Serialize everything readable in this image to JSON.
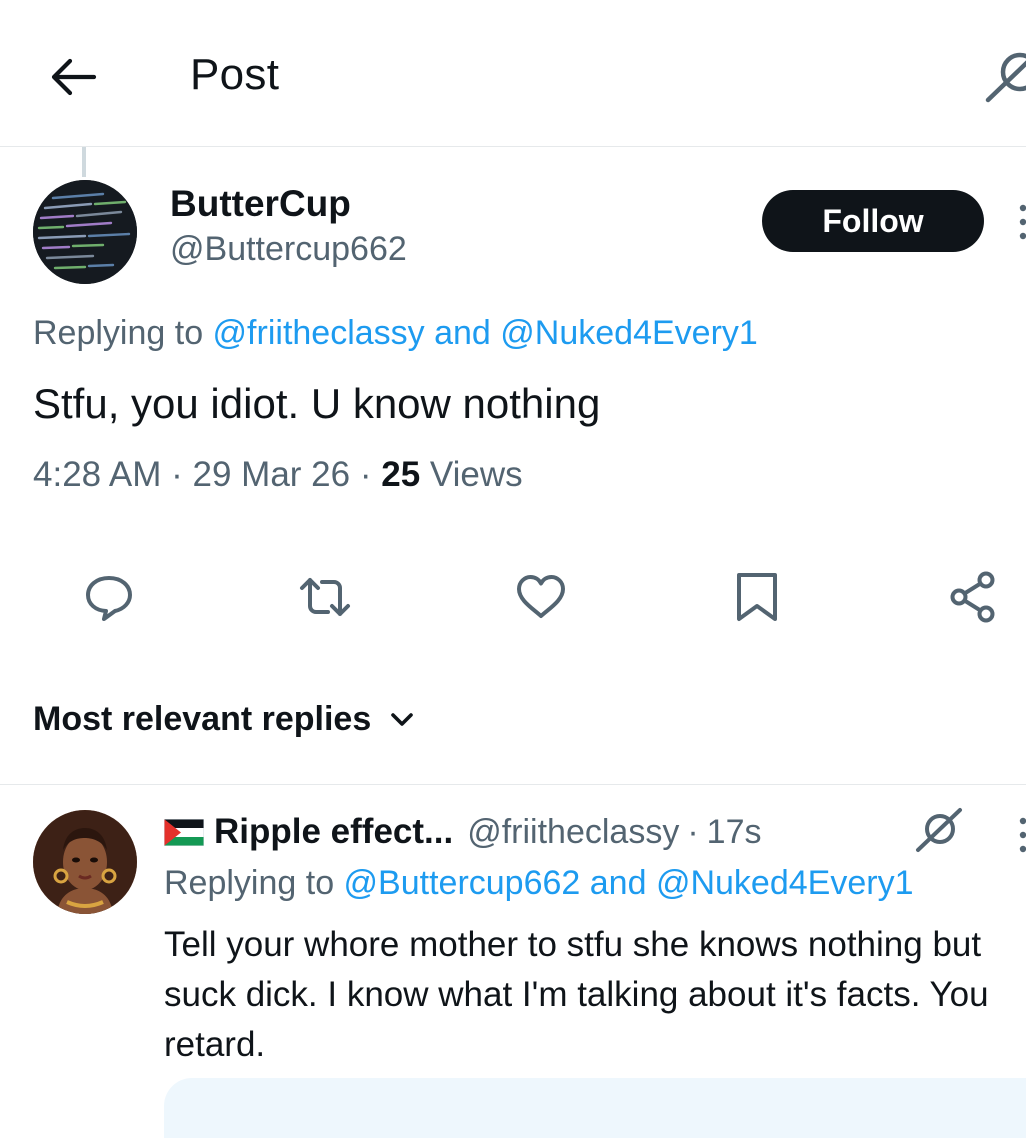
{
  "header": {
    "title": "Post",
    "back_icon": "arrow-left-icon",
    "grok_icon": "grok-icon"
  },
  "post": {
    "author": {
      "display_name": "ButterCup",
      "handle": "@Buttercup662"
    },
    "follow_label": "Follow",
    "replying_prefix": "Replying to ",
    "replying_to": [
      "@friitheclassy",
      "@Nuked4Every1"
    ],
    "replying_joiner": " and ",
    "text": "Stfu, you idiot. U know nothing",
    "time": "4:28 AM",
    "date": "29 Mar 26",
    "views_count": "25",
    "views_label": "Views",
    "separator": " · "
  },
  "actions": [
    {
      "name": "reply",
      "icon": "reply-icon"
    },
    {
      "name": "repost",
      "icon": "repost-icon"
    },
    {
      "name": "like",
      "icon": "heart-icon"
    },
    {
      "name": "bookmark",
      "icon": "bookmark-icon"
    },
    {
      "name": "share",
      "icon": "share-icon"
    }
  ],
  "replies_filter": {
    "label": "Most relevant replies",
    "icon": "chevron-down-icon"
  },
  "reply": {
    "flag_icon": "palestine-flag-icon",
    "display_name": "Ripple effect...",
    "handle": "@friitheclassy",
    "dot": "·",
    "time": "17s",
    "replying_prefix": "Replying to ",
    "replying_to": [
      "@Buttercup662",
      "@Nuked4Every1"
    ],
    "replying_joiner": " and ",
    "text": "Tell your whore mother to stfu she knows nothing but suck dick. I know what I'm talking about it's facts. You retard."
  },
  "colors": {
    "text": "#0f1419",
    "secondary": "#536471",
    "accent": "#1d9bf0",
    "follow_bg": "#0f1419"
  }
}
